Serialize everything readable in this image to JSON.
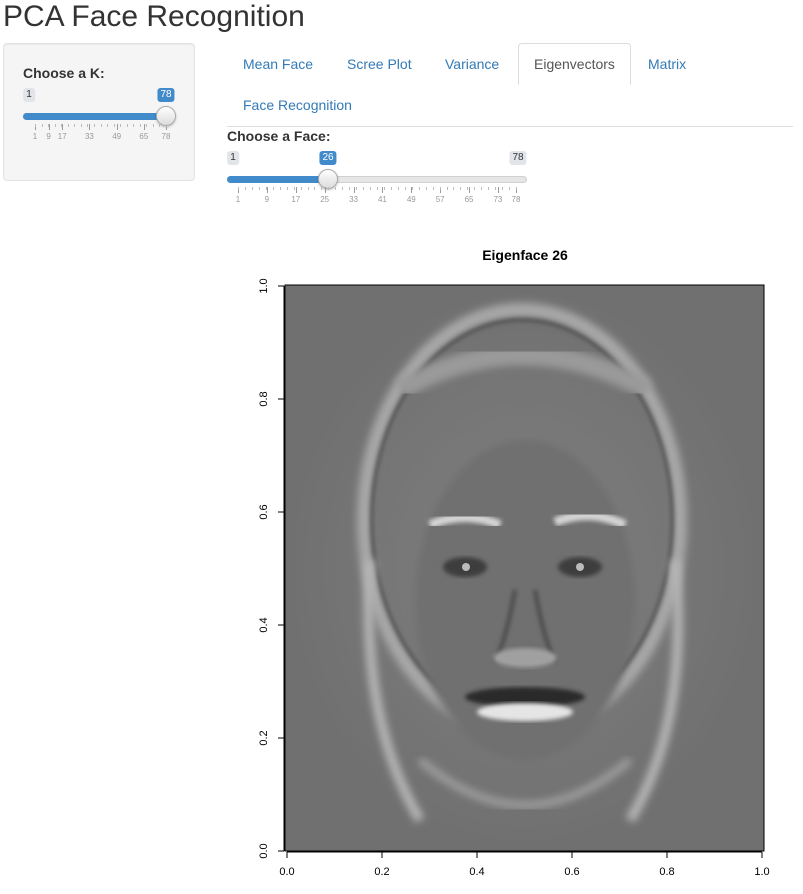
{
  "app": {
    "title": "PCA Face Recognition"
  },
  "sidebar": {
    "k_slider": {
      "label": "Choose a K:",
      "min": 1,
      "max": 78,
      "value": 78,
      "min_label": "1",
      "value_label": "78",
      "ticks": [
        "1",
        "9",
        "17",
        "33",
        "49",
        "65",
        "78"
      ]
    }
  },
  "tabs": [
    {
      "label": "Mean Face",
      "active": false
    },
    {
      "label": "Scree Plot",
      "active": false
    },
    {
      "label": "Variance",
      "active": false
    },
    {
      "label": "Eigenvectors",
      "active": true
    },
    {
      "label": "Matrix",
      "active": false
    },
    {
      "label": "Face Recognition",
      "active": false
    }
  ],
  "face_slider": {
    "label": "Choose a Face:",
    "min": 1,
    "max": 78,
    "value": 26,
    "min_label": "1",
    "value_label": "26",
    "max_label": "78",
    "ticks": [
      "1",
      "9",
      "17",
      "25",
      "33",
      "41",
      "49",
      "57",
      "65",
      "73",
      "78"
    ]
  },
  "plot": {
    "title": "Eigenface 26",
    "x_ticks": [
      "0.0",
      "0.2",
      "0.4",
      "0.6",
      "0.8",
      "1.0"
    ],
    "y_ticks": [
      "0.0",
      "0.2",
      "0.4",
      "0.6",
      "0.8",
      "1.0"
    ],
    "xlim": [
      0,
      1
    ],
    "ylim": [
      0,
      1
    ],
    "image_description_colors": {
      "background": "#7a7a7a",
      "highlight": "#d8d8d8",
      "shadow": "#3c3c3c"
    }
  },
  "colors": {
    "accent": "#428bca",
    "link": "#337ab7"
  }
}
